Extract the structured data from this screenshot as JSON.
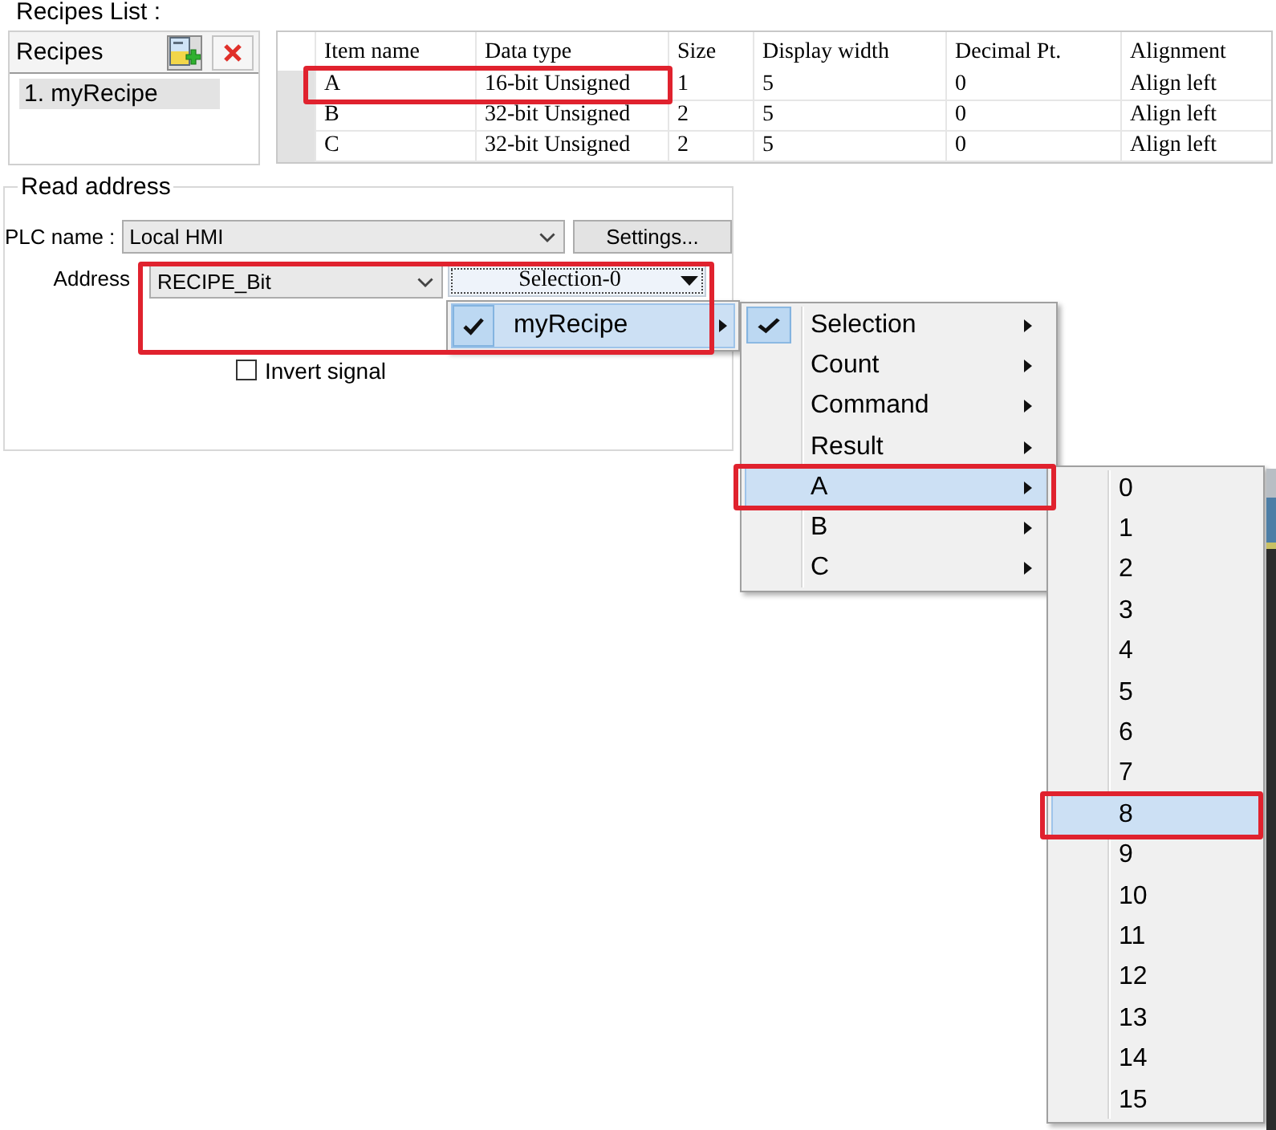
{
  "recipes_list": {
    "title": "Recipes List :",
    "header": "Recipes",
    "items": [
      {
        "label": "1. myRecipe",
        "selected": true
      }
    ]
  },
  "table": {
    "columns": [
      "Item name",
      "Data type",
      "Size",
      "Display width",
      "Decimal Pt.",
      "Alignment"
    ],
    "rows": [
      {
        "cells": [
          "A",
          "16-bit Unsigned",
          "1",
          "5",
          "0",
          "Align left"
        ],
        "annotated": true
      },
      {
        "cells": [
          "B",
          "32-bit Unsigned",
          "2",
          "5",
          "0",
          "Align left"
        ],
        "annotated": false
      },
      {
        "cells": [
          "C",
          "32-bit Unsigned",
          "2",
          "5",
          "0",
          "Align left"
        ],
        "annotated": false
      }
    ]
  },
  "read_address": {
    "title": "Read address",
    "plc_name": {
      "label": "PLC name :",
      "value": "Local HMI"
    },
    "settings_button": "Settings...",
    "address": {
      "label": "Address",
      "device": "RECIPE_Bit",
      "selector": "Selection-0",
      "annotated": true
    },
    "invert_signal": {
      "label": "Invert signal",
      "checked": false
    }
  },
  "menus": [
    {
      "items": [
        {
          "label": "myRecipe",
          "checked": true,
          "selected": true,
          "submenu": true
        }
      ]
    },
    {
      "items": [
        {
          "label": "Selection",
          "checked": true,
          "selected": false,
          "submenu": true,
          "annotated": false
        },
        {
          "label": "Count",
          "checked": false,
          "selected": false,
          "submenu": true,
          "annotated": false
        },
        {
          "label": "Command",
          "checked": false,
          "selected": false,
          "submenu": true,
          "annotated": false
        },
        {
          "label": "Result",
          "checked": false,
          "selected": false,
          "submenu": true,
          "annotated": false
        },
        {
          "label": "A",
          "checked": false,
          "selected": true,
          "submenu": true,
          "annotated": true
        },
        {
          "label": "B",
          "checked": false,
          "selected": false,
          "submenu": true,
          "annotated": false
        },
        {
          "label": "C",
          "checked": false,
          "selected": false,
          "submenu": true,
          "annotated": false
        }
      ]
    },
    {
      "items": [
        {
          "label": "0",
          "selected": false,
          "annotated": false
        },
        {
          "label": "1",
          "selected": false,
          "annotated": false
        },
        {
          "label": "2",
          "selected": false,
          "annotated": false
        },
        {
          "label": "3",
          "selected": false,
          "annotated": false
        },
        {
          "label": "4",
          "selected": false,
          "annotated": false
        },
        {
          "label": "5",
          "selected": false,
          "annotated": false
        },
        {
          "label": "6",
          "selected": false,
          "annotated": false
        },
        {
          "label": "7",
          "selected": false,
          "annotated": false
        },
        {
          "label": "8",
          "selected": true,
          "annotated": true
        },
        {
          "label": "9",
          "selected": false,
          "annotated": false
        },
        {
          "label": "10",
          "selected": false,
          "annotated": false
        },
        {
          "label": "11",
          "selected": false,
          "annotated": false
        },
        {
          "label": "12",
          "selected": false,
          "annotated": false
        },
        {
          "label": "13",
          "selected": false,
          "annotated": false
        },
        {
          "label": "14",
          "selected": false,
          "annotated": false
        },
        {
          "label": "15",
          "selected": false,
          "annotated": false
        }
      ]
    }
  ]
}
